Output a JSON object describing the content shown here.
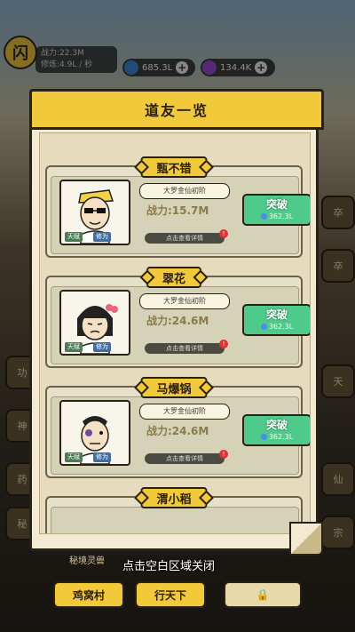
{
  "hud": {
    "avatar_char": "闪",
    "power_line": "战力:22.3M",
    "exp_line": "修炼:4.9L / 秒",
    "currency_blue": "685.3L",
    "currency_purple": "134.4K",
    "plus": "+"
  },
  "modal": {
    "title": "道友一览",
    "close_hint": "点击空白区域关闭"
  },
  "friends": [
    {
      "name": "甄不错",
      "realm": "大罗金仙初阶",
      "power": "战力:15.7M",
      "tag_a": "天赋",
      "tag_b": "修为",
      "detail": "点击查看详情",
      "break_label": "突破",
      "break_cost": "362.3L"
    },
    {
      "name": "翠花",
      "realm": "大罗金仙初阶",
      "power": "战力:24.6M",
      "tag_a": "天赋",
      "tag_b": "修为",
      "detail": "点击查看详情",
      "break_label": "突破",
      "break_cost": "362.3L"
    },
    {
      "name": "马爆锅",
      "realm": "大罗金仙初阶",
      "power": "战力:24.6M",
      "tag_a": "天赋",
      "tag_b": "修为",
      "detail": "点击查看详情",
      "break_label": "突破",
      "break_cost": "362.3L"
    },
    {
      "name": "渭小稻"
    }
  ],
  "bottom": {
    "label": "秘境灵兽",
    "btn1": "鸡窝村",
    "btn2": "行天下",
    "lock": "🔒"
  }
}
